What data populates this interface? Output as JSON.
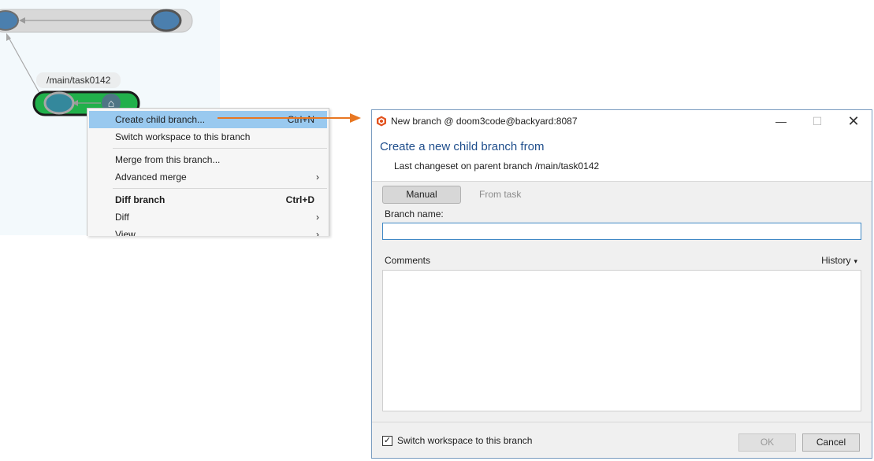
{
  "explorer": {
    "branch_label": "/main/task0142"
  },
  "context_menu": {
    "items": [
      {
        "label": "Create child branch...",
        "shortcut": "Ctrl+N"
      },
      {
        "label": "Switch workspace to this branch",
        "shortcut": ""
      },
      {
        "label": "Merge from this branch...",
        "shortcut": ""
      },
      {
        "label": "Advanced merge",
        "shortcut": ""
      },
      {
        "label": "Diff branch",
        "shortcut": "Ctrl+D"
      },
      {
        "label": "Diff",
        "shortcut": ""
      },
      {
        "label": "View",
        "shortcut": ""
      }
    ],
    "chevron": "›"
  },
  "dialog": {
    "title": "New branch @ doom3code@backyard:8087",
    "minimize_glyph": "—",
    "maximize_glyph": "☐",
    "close_glyph": "✕",
    "header_title": "Create a new child branch from",
    "header_subtitle": "Last changeset on parent branch /main/task0142",
    "tab_manual": "Manual",
    "tab_from_task": "From task",
    "branch_name_label": "Branch name:",
    "branch_name_value": "",
    "comments_label": "Comments",
    "history_label": "History",
    "comments_value": "",
    "switch_workspace_label": "Switch workspace to this branch",
    "switch_workspace_checked": "✓",
    "ok_label": "OK",
    "cancel_label": "Cancel"
  },
  "icons": {
    "home": "home-icon",
    "app": "plastic-scm-icon",
    "history_caret": "▾"
  },
  "colors": {
    "highlight": "#99c9ef",
    "header_title": "#1f4e8c",
    "callout_arrow": "#e87722",
    "branch_green": "#21b04b"
  }
}
